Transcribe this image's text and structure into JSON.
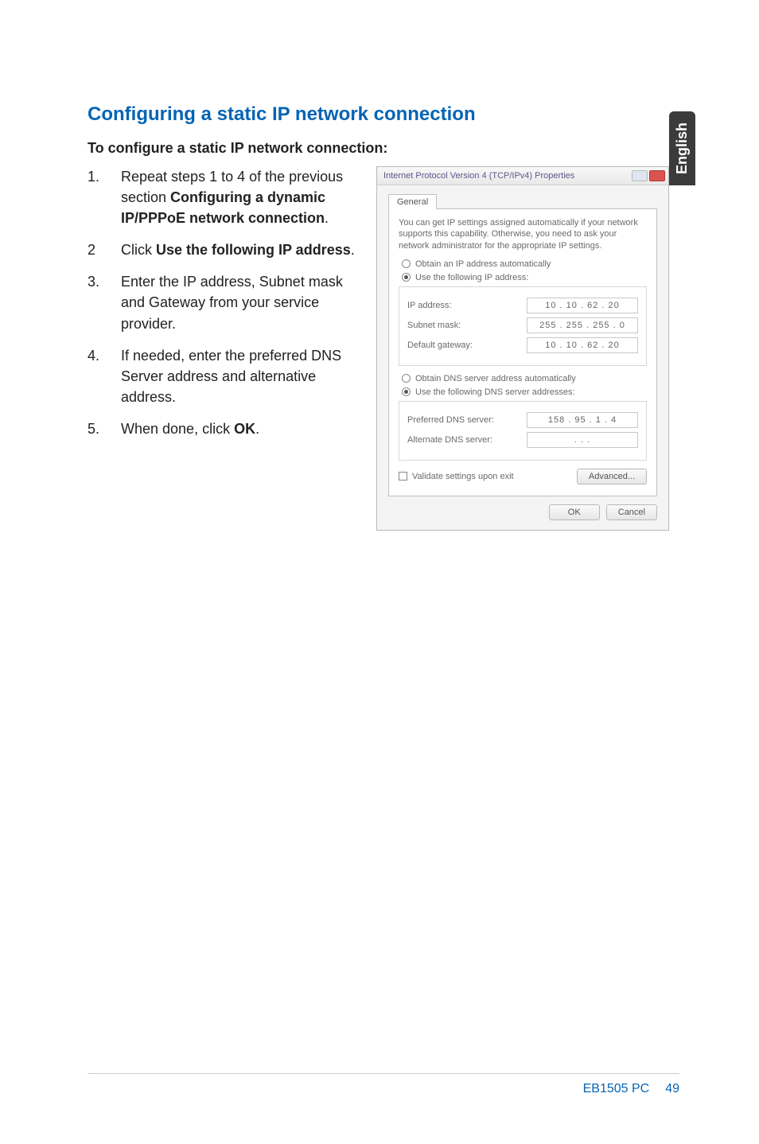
{
  "language_tab": "English",
  "section_title": "Configuring a static IP network connection",
  "sub_title": "To configure a static IP network connection:",
  "steps": [
    {
      "num": "1.",
      "pre": "Repeat steps 1 to 4 of the previous section ",
      "bold": "Configuring a dynamic IP/PPPoE network connection",
      "post": "."
    },
    {
      "num": "2",
      "pre": "Click ",
      "bold": "Use the following IP address",
      "post": "."
    },
    {
      "num": "3.",
      "pre": "Enter the IP address, Subnet mask and Gateway from your service provider.",
      "bold": "",
      "post": ""
    },
    {
      "num": "4.",
      "pre": "If needed, enter the preferred DNS Server address and alternative address.",
      "bold": "",
      "post": ""
    },
    {
      "num": "5.",
      "pre": "When done, click ",
      "bold": "OK",
      "post": "."
    }
  ],
  "dialog": {
    "title": "Internet Protocol Version 4 (TCP/IPv4) Properties",
    "tab": "General",
    "description": "You can get IP settings assigned automatically if your network supports this capability. Otherwise, you need to ask your network administrator for the appropriate IP settings.",
    "opt_obtain_ip": "Obtain an IP address automatically",
    "opt_use_ip": "Use the following IP address:",
    "ip_address_label": "IP address:",
    "ip_address_value": "10 . 10 . 62 . 20",
    "subnet_label": "Subnet mask:",
    "subnet_value": "255 . 255 . 255 . 0",
    "gateway_label": "Default gateway:",
    "gateway_value": "10 . 10 . 62 . 20",
    "opt_obtain_dns": "Obtain DNS server address automatically",
    "opt_use_dns": "Use the following DNS server addresses:",
    "pref_dns_label": "Preferred DNS server:",
    "pref_dns_value": "158 . 95 . 1 . 4",
    "alt_dns_label": "Alternate DNS server:",
    "alt_dns_value": ".   .   .",
    "validate_label": "Validate settings upon exit",
    "advanced_btn": "Advanced...",
    "ok_btn": "OK",
    "cancel_btn": "Cancel"
  },
  "footer": {
    "label": "EB1505 PC",
    "page": "49"
  }
}
